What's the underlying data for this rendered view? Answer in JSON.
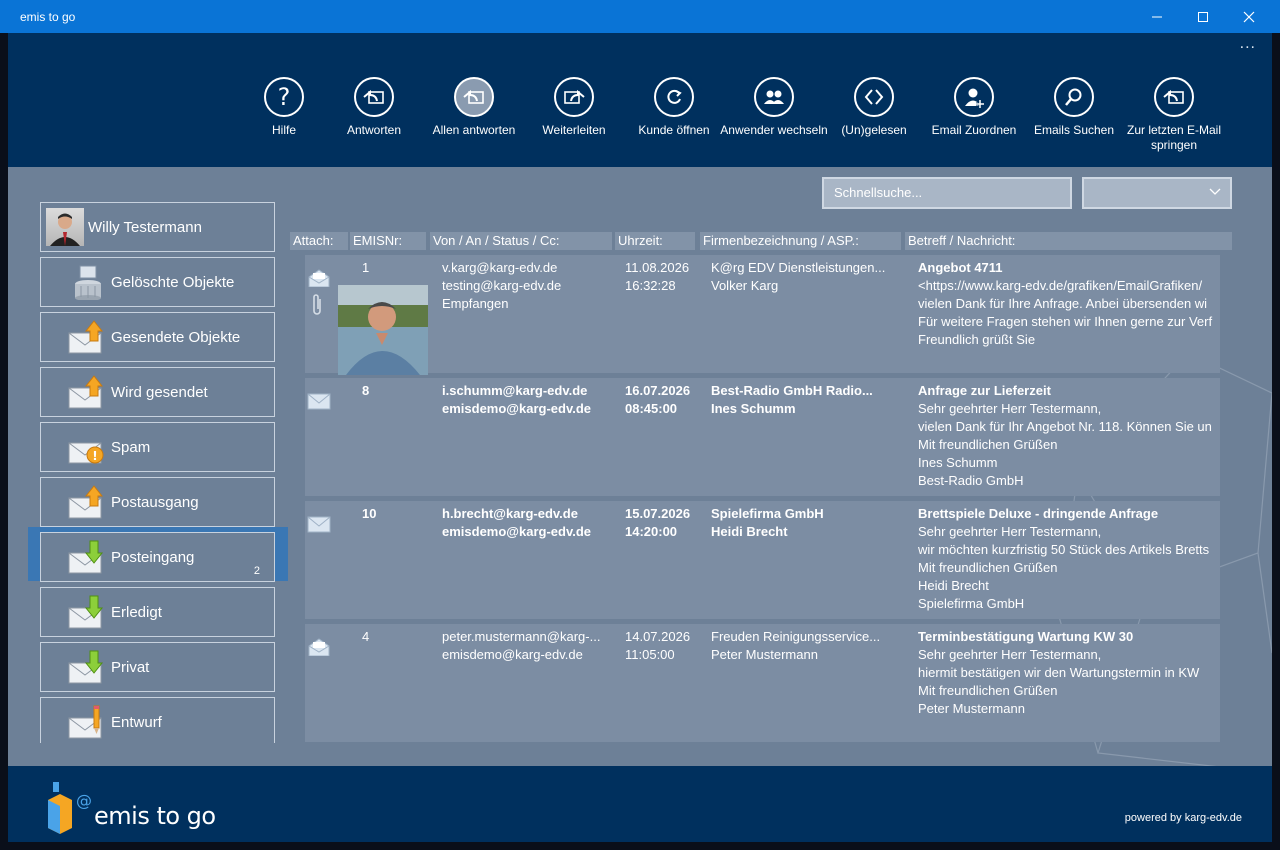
{
  "window": {
    "title": "emis to go"
  },
  "toolbar": {
    "more": "...",
    "buttons": [
      {
        "label": "Hilfe",
        "icon": "help-icon"
      },
      {
        "label": "Antworten",
        "icon": "reply-icon"
      },
      {
        "label": "Allen antworten",
        "icon": "reply-all-icon"
      },
      {
        "label": "Weiterleiten",
        "icon": "forward-icon"
      },
      {
        "label": "Kunde öffnen",
        "icon": "open-customer-icon"
      },
      {
        "label": "Anwender wechseln",
        "icon": "switch-user-icon"
      },
      {
        "label": "(Un)gelesen",
        "icon": "read-unread-icon"
      },
      {
        "label": "Email Zuordnen",
        "icon": "assign-email-icon"
      },
      {
        "label": "Emails Suchen",
        "icon": "search-icon"
      },
      {
        "label": "Zur letzten E-Mail springen",
        "icon": "jump-last-email-icon"
      }
    ]
  },
  "search": {
    "placeholder": "Schnellsuche..."
  },
  "sidebar": {
    "user": "Willy Testermann",
    "folders": [
      {
        "name": "Gelöschte Objekte",
        "icon": "trash-icon"
      },
      {
        "name": "Gesendete Objekte",
        "icon": "sent-icon"
      },
      {
        "name": "Wird gesendet",
        "icon": "sending-icon"
      },
      {
        "name": "Spam",
        "icon": "spam-icon"
      },
      {
        "name": "Postausgang",
        "icon": "outbox-icon"
      },
      {
        "name": "Posteingang",
        "icon": "inbox-icon",
        "count": "2"
      },
      {
        "name": "Erledigt",
        "icon": "done-icon"
      },
      {
        "name": "Privat",
        "icon": "private-icon"
      },
      {
        "name": "Entwurf",
        "icon": "draft-icon"
      }
    ]
  },
  "list": {
    "headers": [
      "Attach:",
      "EMISNr:",
      "Von / An / Status / Cc:",
      "Uhrzeit:",
      "Firmenbezeichnung / ASP.:",
      "Betreff / Nachricht:"
    ],
    "rows": [
      {
        "nr": "1",
        "from": "v.karg@karg-edv.de",
        "to": "testing@karg-edv.de",
        "status": "Empfangen",
        "date": "11.08.2026",
        "time": "16:32:28",
        "company": "K@rg EDV Dienstleistungen...",
        "contact": "Volker Karg",
        "subject": "Angebot 4711",
        "body": [
          "<https://www.karg-edv.de/grafiken/EmailGrafiken/",
          "vielen Dank für Ihre Anfrage. Anbei übersenden wi",
          "Für weitere Fragen stehen wir Ihnen gerne zur Verf",
          "Freundlich grüßt Sie"
        ],
        "bold": false
      },
      {
        "nr": "8",
        "from": "i.schumm@karg-edv.de",
        "to": "emisdemo@karg-edv.de",
        "status": "",
        "date": "16.07.2026",
        "time": "08:45:00",
        "company": "Best-Radio GmbH Radio...",
        "contact": "Ines Schumm",
        "subject": "Anfrage zur Lieferzeit",
        "body": [
          "Sehr geehrter Herr Testermann,",
          "vielen Dank für Ihr Angebot Nr. 118. Können Sie un",
          "Mit freundlichen Grüßen",
          "Ines Schumm",
          "Best-Radio GmbH"
        ],
        "bold": true
      },
      {
        "nr": "10",
        "from": "h.brecht@karg-edv.de",
        "to": "emisdemo@karg-edv.de",
        "status": "",
        "date": "15.07.2026",
        "time": "14:20:00",
        "company": "Spielefirma GmbH",
        "contact": "Heidi Brecht",
        "subject": "Brettspiele Deluxe - dringende Anfrage",
        "body": [
          "Sehr geehrter Herr Testermann,",
          "wir möchten kurzfristig 50 Stück des Artikels Bretts",
          "Mit freundlichen Grüßen",
          "Heidi Brecht",
          "Spielefirma GmbH"
        ],
        "bold": true
      },
      {
        "nr": "4",
        "from": "peter.mustermann@karg-...",
        "to": "emisdemo@karg-edv.de",
        "status": "",
        "date": "14.07.2026",
        "time": "11:05:00",
        "company": "Freuden Reinigungsservice...",
        "contact": "Peter Mustermann",
        "subject": "Terminbestätigung Wartung KW 30",
        "body": [
          "Sehr geehrter Herr Testermann,",
          "hiermit bestätigen wir den Wartungstermin in KW",
          "Mit freundlichen Grüßen",
          "Peter Mustermann"
        ],
        "bold": false
      }
    ]
  },
  "footer": {
    "brand": "emis to go",
    "at": "@",
    "powered": "powered by karg-edv.de"
  },
  "colors": {
    "titlebar": "#0a74d6",
    "toolbar": "#00305e",
    "content": "#6d8097",
    "row": "#7c8da3",
    "selection": "#3a77b4"
  }
}
